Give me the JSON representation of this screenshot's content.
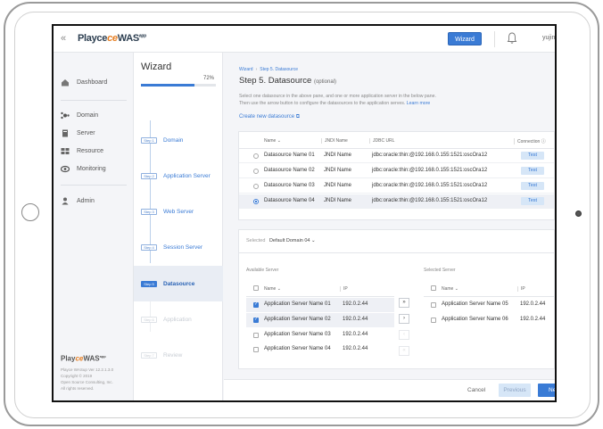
{
  "topbar": {
    "logo_main": "Playce",
    "logo_ce": "",
    "logo_brand": "WAS",
    "logo_sup": "app",
    "wizard_button": "Wizard",
    "user": "yujin"
  },
  "sidebar": {
    "items": [
      {
        "label": "Dashboard",
        "icon": "home-icon"
      },
      {
        "label": "Domain",
        "icon": "domain-icon"
      },
      {
        "label": "Server",
        "icon": "server-icon"
      },
      {
        "label": "Resource",
        "icon": "resource-icon"
      },
      {
        "label": "Monitoring",
        "icon": "eye-icon"
      },
      {
        "label": "Admin",
        "icon": "user-icon"
      }
    ],
    "footer_logo": "PlayceWAS",
    "footer_lines": [
      "Playce WASup Ver 12.2.1.3.0",
      "Copyright © 2019",
      "Open Source Consulting, Inc.",
      "All rights reserved."
    ]
  },
  "wizard": {
    "title": "Wizard",
    "progress_pct": "72%",
    "progress_value": 0.72,
    "steps": [
      {
        "badge": "Step 1",
        "label": "Domain",
        "state": "done"
      },
      {
        "badge": "Step 2",
        "label": "Application Server",
        "state": "done"
      },
      {
        "badge": "Step 3",
        "label": "Web Server",
        "state": "done"
      },
      {
        "badge": "Step 4",
        "label": "Session Server",
        "state": "done"
      },
      {
        "badge": "Step 5",
        "label": "Datasource",
        "state": "active"
      },
      {
        "badge": "Step 6",
        "label": "Application",
        "state": "disabled"
      },
      {
        "badge": "Step 7",
        "label": "Review",
        "state": "disabled"
      }
    ]
  },
  "main": {
    "breadcrumb": [
      "Wizard",
      "Step 5. Datasource"
    ],
    "title": "Step 5. Datasource",
    "title_optional": "(optional)",
    "desc_line1": "Select one datasource in the above pane, and one or more application server in the below pane.",
    "desc_line2": "Then use the arrow button to configure the datasources to the application serves.",
    "learn_more": "Learn more",
    "create_link": "Create new datasource",
    "ds_table": {
      "headers": [
        "Name",
        "JNDI Name",
        "JDBC URL",
        "Connection"
      ],
      "rows": [
        {
          "name": "Datasource Name 01",
          "jndi": "JNDI Name",
          "url": "jdbc:oracle:thin:@192.168.0.155:1521:oscOra12",
          "action": "Test",
          "selected": false
        },
        {
          "name": "Datasource Name 02",
          "jndi": "JNDI Name",
          "url": "jdbc:oracle:thin:@192.168.0.155:1521:oscOra12",
          "action": "Test",
          "selected": false
        },
        {
          "name": "Datasource Name 03",
          "jndi": "JNDI Name",
          "url": "jdbc:oracle:thin:@192.168.0.155:1521:oscOra12",
          "action": "Test",
          "selected": false
        },
        {
          "name": "Datasource Name 04",
          "jndi": "JNDI Name",
          "url": "jdbc:oracle:thin:@192.168.0.155:1521:oscOra12",
          "action": "Test",
          "selected": true
        }
      ]
    },
    "selected_label": "Selected",
    "selected_domain": "Default Domain 04",
    "available": {
      "title": "Available Server",
      "headers": [
        "Name",
        "IP"
      ],
      "rows": [
        {
          "name": "Application Server Name 01",
          "ip": "192.0.2.44",
          "checked": true
        },
        {
          "name": "Application Server Name 02",
          "ip": "192.0.2.44",
          "checked": true
        },
        {
          "name": "Application Server Name 03",
          "ip": "192.0.2.44",
          "checked": false
        },
        {
          "name": "Application Server Name 04",
          "ip": "192.0.2.44",
          "checked": false
        }
      ]
    },
    "arrows": [
      "»",
      "›",
      "‹",
      "«"
    ],
    "selected_servers": {
      "title": "Selected Server",
      "headers": [
        "Name",
        "IP"
      ],
      "rows": [
        {
          "name": "Application Server Name 05",
          "ip": "192.0.2.44",
          "checked": false
        },
        {
          "name": "Application Server Name 06",
          "ip": "192.0.2.44",
          "checked": false
        }
      ]
    }
  },
  "footer": {
    "cancel": "Cancel",
    "previous": "Previous",
    "next": "Next"
  }
}
